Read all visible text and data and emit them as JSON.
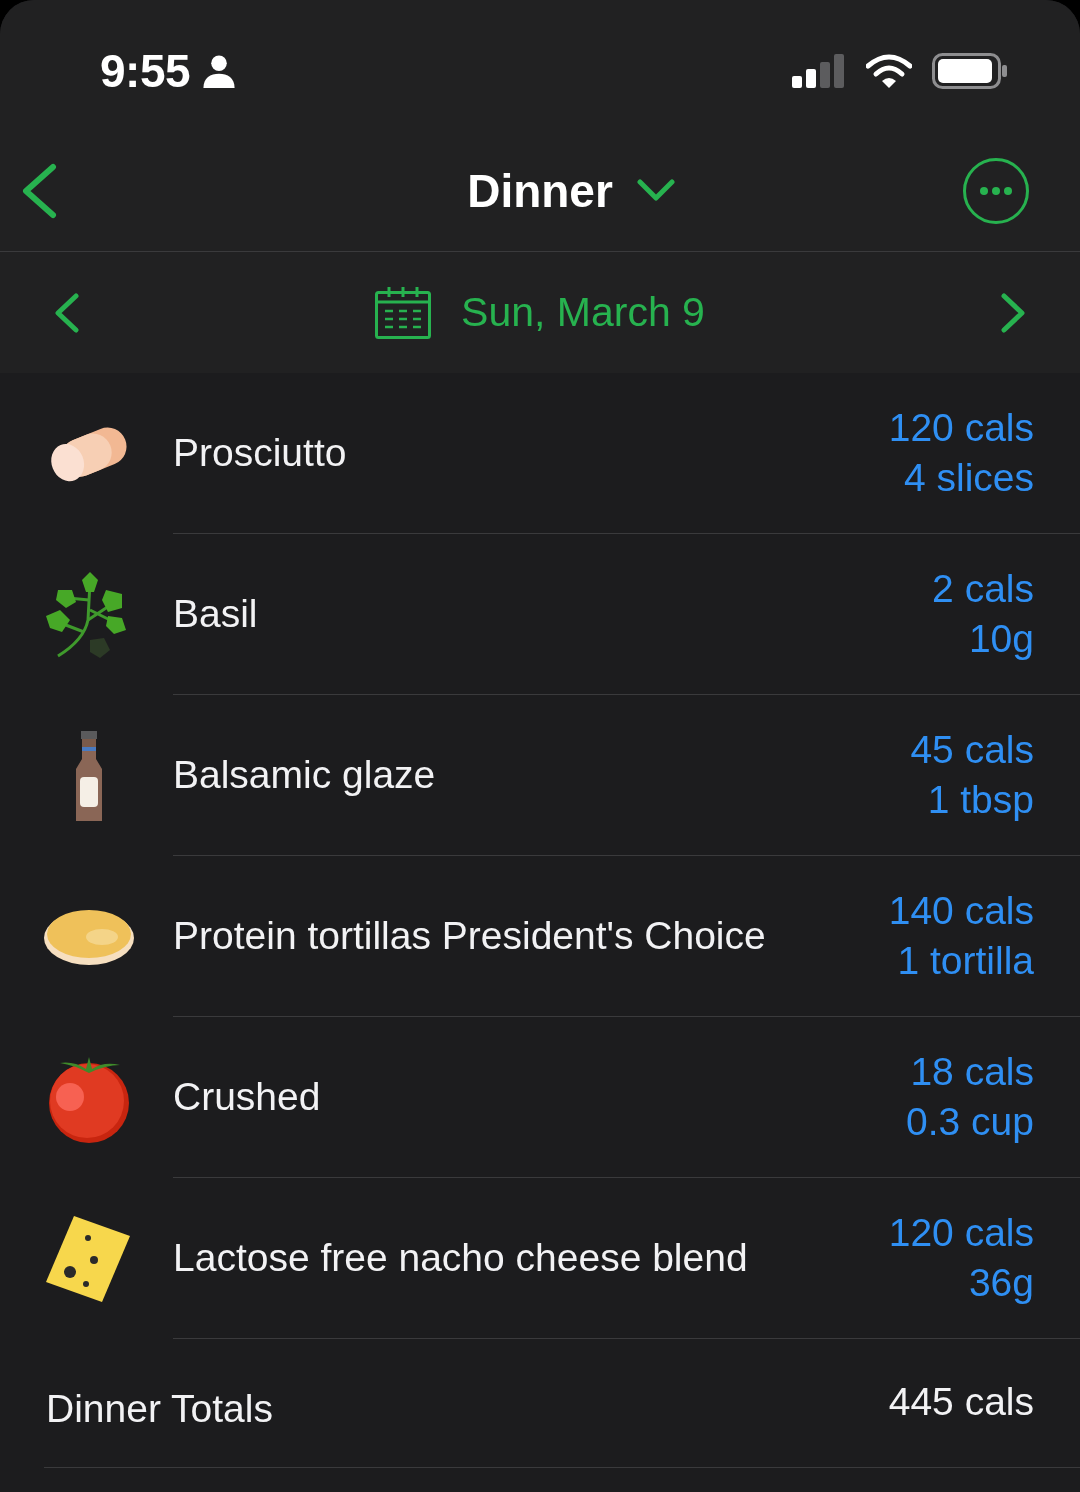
{
  "status_bar": {
    "time": "9:55"
  },
  "nav": {
    "title": "Dinner"
  },
  "date_bar": {
    "date": "Sun, March 9"
  },
  "foods": [
    {
      "name": "Prosciutto",
      "kind": "ham",
      "calories": "120 cals",
      "serving": "4 slices"
    },
    {
      "name": "Basil",
      "kind": "herb",
      "calories": "2 cals",
      "serving": "10g"
    },
    {
      "name": "Balsamic glaze",
      "kind": "bottle",
      "calories": "45 cals",
      "serving": "1 tbsp"
    },
    {
      "name": "Protein tortillas President's Choice",
      "kind": "tortilla",
      "calories": "140 cals",
      "serving": "1 tortilla"
    },
    {
      "name": "Crushed",
      "kind": "tomato",
      "calories": "18 cals",
      "serving": "0.3 cup"
    },
    {
      "name": "Lactose free nacho cheese blend",
      "kind": "cheese",
      "calories": "120 cals",
      "serving": "36g"
    }
  ],
  "totals": {
    "label": "Dinner Totals",
    "calories": "445 cals"
  }
}
